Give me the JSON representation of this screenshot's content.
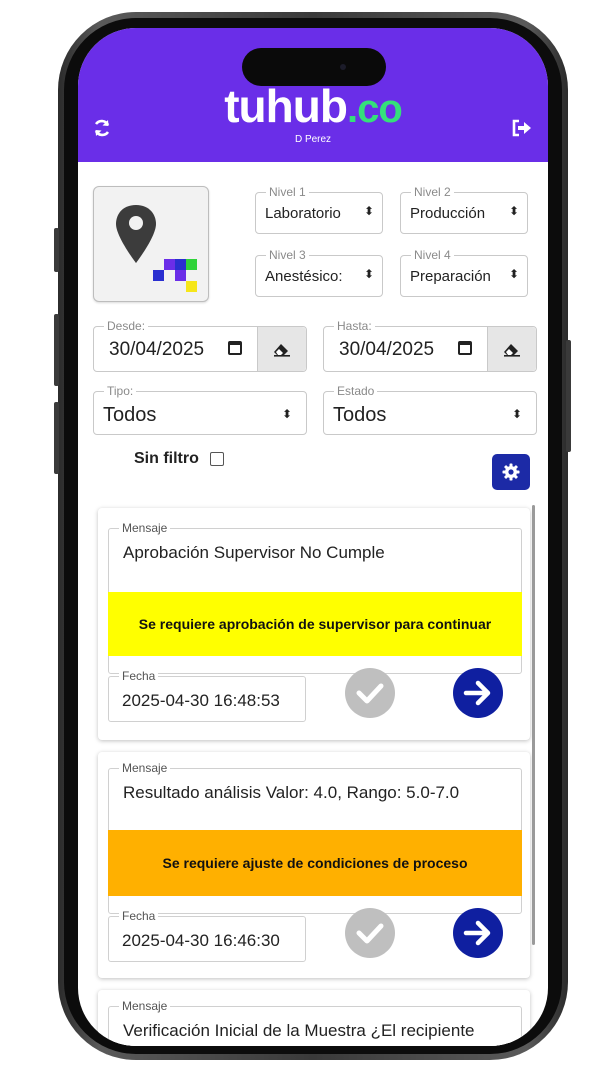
{
  "header": {
    "logo_main": "tuhub",
    "logo_tld": ".co",
    "user": "D Perez",
    "refresh_icon": "refresh-icon",
    "logout_icon": "logout-icon",
    "color": "#6a2ee8"
  },
  "filters": {
    "nivel1": {
      "label": "Nivel 1",
      "value": "Laboratorio"
    },
    "nivel2": {
      "label": "Nivel 2",
      "value": "Producción"
    },
    "nivel3": {
      "label": "Nivel 3",
      "value": "Anestésico:"
    },
    "nivel4": {
      "label": "Nivel 4",
      "value": "Preparación"
    },
    "desde": {
      "label": "Desde:",
      "value": "30/04/2025"
    },
    "hasta": {
      "label": "Hasta:",
      "value": "30/04/2025"
    },
    "tipo": {
      "label": "Tipo:",
      "value": "Todos"
    },
    "estado": {
      "label": "Estado",
      "value": "Todos"
    },
    "sin_filtro": "Sin filtro"
  },
  "messages": [
    {
      "label": "Mensaje",
      "text": "Aprobación Supervisor No Cumple",
      "banner": "Se requiere aprobación de supervisor para continuar",
      "banner_color": "#ffff00",
      "date_label": "Fecha",
      "date": "2025-04-30 16:48:53"
    },
    {
      "label": "Mensaje",
      "text": "Resultado análisis Valor: 4.0, Rango: 5.0-7.0",
      "banner": "Se requiere ajuste de condiciones de proceso",
      "banner_color": "#ffb000",
      "date_label": "Fecha",
      "date": "2025-04-30 16:46:30"
    },
    {
      "label": "Mensaje",
      "text": "Verificación Inicial de la Muestra ¿El recipiente"
    }
  ],
  "arrows": {
    "select": "⬍"
  }
}
